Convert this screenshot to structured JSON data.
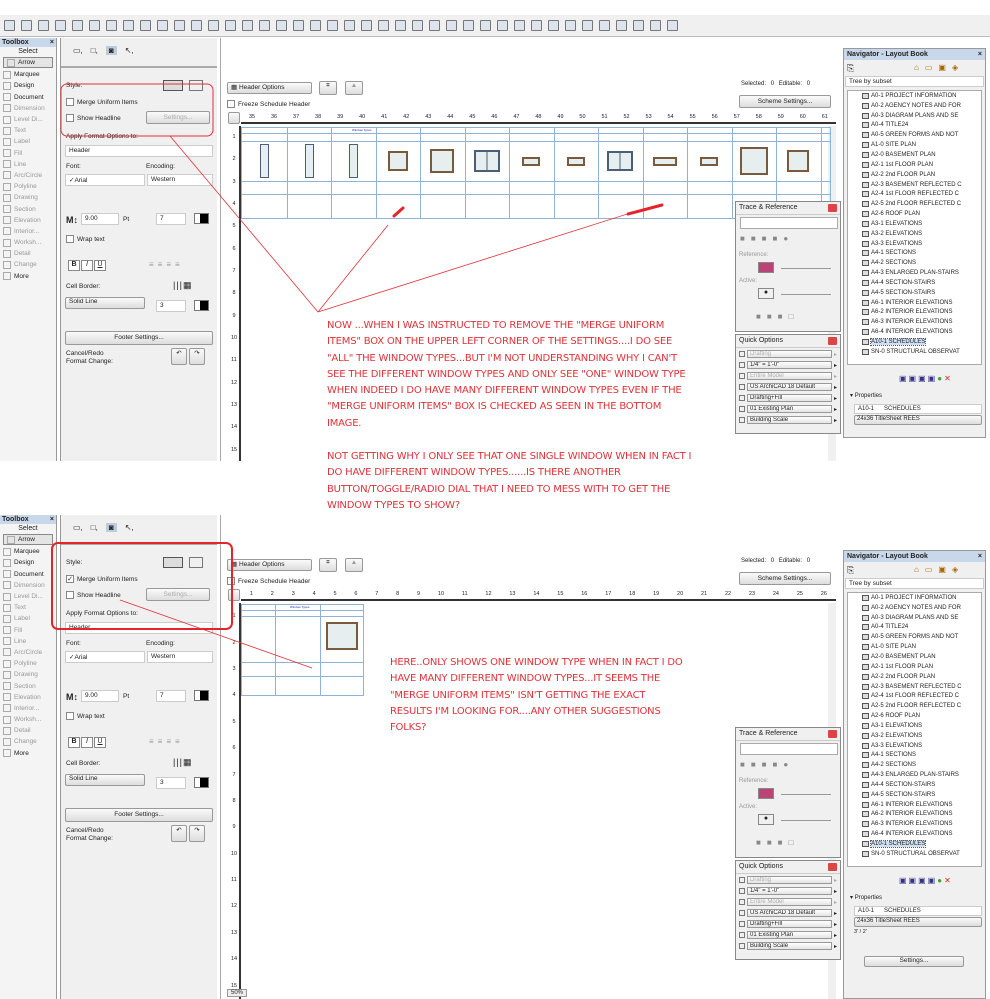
{
  "colors": {
    "annotation": "#e0323a",
    "grid": "#8fb3d6",
    "frame": "#7a5a3c",
    "titlebar": "#c9d7ea"
  },
  "top": {
    "toolbox": {
      "title": "Toolbox",
      "select": "Select",
      "tools": [
        "Arrow",
        "Marquee",
        "Design",
        "Document",
        "Dimension",
        "Level Di...",
        "Text",
        "Label",
        "Fill",
        "Line",
        "Arc/Circle",
        "Polyline",
        "Drawing",
        "Section",
        "Elevation",
        "Interior...",
        "Worksh...",
        "Detail",
        "Change",
        "More"
      ]
    },
    "info": {
      "style": "Style:",
      "merge": "Merge Uniform Items",
      "merge_checked": false,
      "headline": "Show Headline",
      "settings": "Settings...",
      "apply": "Apply Format Options to:",
      "apply_val": "Header",
      "font": "Font:",
      "font_val": "✓Arial",
      "encoding": "Encoding:",
      "encoding_val": "Western",
      "size": "9.00",
      "pt": "Pt",
      "pen": "7",
      "wrap": "Wrap text",
      "bold": "B",
      "italic": "I",
      "underline": "U",
      "border": "Cell Border:",
      "line": "Solid Line",
      "pen2": "3",
      "footer": "Footer Settings...",
      "cancel": "Cancel/Redo",
      "format": "Format Change:"
    },
    "sched": {
      "header_options": "Header Options",
      "freeze": "Freeze Schedule Header",
      "selected": "Selected:",
      "selected_val": "0",
      "editable": "Editable:",
      "editable_val": "0",
      "scheme": "Scheme Settings...",
      "title": "Window Types",
      "ruler": [
        "35",
        "36",
        "37",
        "38",
        "39",
        "40",
        "41",
        "42",
        "43",
        "44",
        "45",
        "46",
        "47",
        "48",
        "49",
        "50",
        "51",
        "52",
        "53",
        "54",
        "55",
        "56",
        "57",
        "58",
        "59",
        "60",
        "61"
      ],
      "vruler": [
        "1",
        "2",
        "3",
        "4",
        "5",
        "6",
        "7",
        "8",
        "9",
        "10",
        "11",
        "12",
        "13",
        "14",
        "15"
      ]
    },
    "trace": {
      "title": "Trace & Reference",
      "reference": "Reference:",
      "active": "Active:"
    },
    "quick": {
      "title": "Quick Options",
      "rows": [
        "Drafting",
        "1/4\"  =  1'-0\"",
        "Entire Model",
        "US ArchiCAD 18 Default",
        "Drafting+Fill",
        "01 Existing Plan",
        "Building Scale"
      ]
    },
    "nav": {
      "title": "Navigator - Layout Book",
      "tree": "Tree by subset",
      "items": [
        "A0-1 PROJECT INFORMATION",
        "A0-2 AGENCY NOTES AND FOR",
        "A0-3 DIAGRAM PLANS AND SE",
        "A0-4 TITLE24",
        "A0-5 GREEN FORMS AND NOT",
        "A1-0 SITE PLAN",
        "A2-0 BASEMENT PLAN",
        "A2-1 1st FLOOR PLAN",
        "A2-2 2nd FLOOR PLAN",
        "A2-3 BASEMENT REFLECTED C",
        "A2-4 1st FLOOR REFLECTED C",
        "A2-5 2nd FLOOR REFLECTED C",
        "A2-6 ROOF PLAN",
        "A3-1 ELEVATIONS",
        "A3-2 ELEVATIONS",
        "A3-3 ELEVATIONS",
        "A4-1 SECTIONS",
        "A4-2 SECTIONS",
        "A4-3 ENLARGED PLAN-STAIRS",
        "A4-4 SECTION-STAIRS",
        "A4-5 SECTION-STAIRS",
        "A6-1 INTERIOR ELEVATIONS",
        "A6-2 INTERIOR ELEVATIONS",
        "A6-3 INTERIOR ELEVATIONS",
        "A6-4 INTERIOR ELEVATIONS",
        "A10-1 SCHEDULES",
        "SN-0 STRUCTURAL OBSERVAT"
      ],
      "properties": "Properties",
      "id": "A10-1",
      "name": "SCHEDULES",
      "master": "24x36 TitleSheet REES"
    },
    "note": [
      "NOW ...WHEN I WAS INSTRUCTED TO REMOVE THE \"MERGE UNIFORM ITEMS\" BOX ON THE UPPER LEFT CORNER OF THE SETTINGS....I DO SEE \"ALL\" THE WINDOW TYPES...BUT I'M NOT UNDERSTANDING WHY I CAN'T SEE THE DIFFERENT WINDOW TYPES AND ONLY SEE \"ONE\" WINDOW TYPE WHEN INDEED I DO HAVE MANY DIFFERENT WINDOW TYPES EVEN IF THE \"MERGE UNIFORM ITEMS\" BOX IS CHECKED AS SEEN IN THE BOTTOM IMAGE.",
      "NOT GETTING WHY I ONLY SEE THAT ONE SINGLE WINDOW WHEN IN FACT I DO HAVE DIFFERENT WINDOW TYPES......IS THERE ANOTHER BUTTON/TOGGLE/RADIO DIAL THAT I NEED TO MESS WITH TO GET THE WINDOW TYPES TO SHOW?"
    ]
  },
  "bottom": {
    "info": {
      "merge_checked": true
    },
    "sched": {
      "ruler": [
        "1",
        "2",
        "3",
        "4",
        "5",
        "6",
        "7",
        "8",
        "9",
        "10",
        "11",
        "12",
        "13",
        "14",
        "15",
        "16",
        "17",
        "18",
        "19",
        "20",
        "21",
        "22",
        "23",
        "24",
        "25",
        "26"
      ],
      "zoom": "50%"
    },
    "nav": {
      "scale": "3' / 2'",
      "settings": "Settings..."
    },
    "note": "HERE..ONLY SHOWS ONE WINDOW TYPE WHEN IN FACT I DO HAVE MANY DIFFERENT WINDOW TYPES...IT SEEMS THE \"MERGE UNIFORM ITEMS\" ISN'T GETTING THE EXACT RESULTS I'M LOOKING FOR....ANY OTHER SUGGESTIONS FOLKS?"
  }
}
